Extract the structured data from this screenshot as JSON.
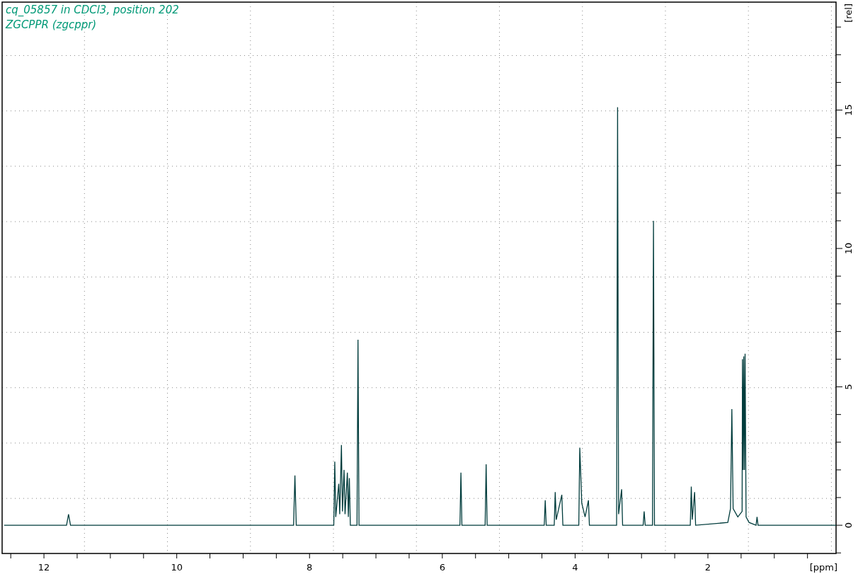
{
  "header": {
    "sample": "cq_05857 in CDCl3, position 202",
    "pulse_program": "ZGCPPR (zgcppr)"
  },
  "spectrum": {
    "chart_data": {
      "type": "line",
      "xlabel": "[ppm]",
      "ylabel": "[rel]",
      "xlim": [
        12.63,
        0.07
      ],
      "ylim": [
        -1.02,
        18.9
      ],
      "xticks": [
        12,
        10,
        8,
        6,
        4,
        2
      ],
      "yticks": [
        0,
        5,
        10,
        15
      ],
      "x": [
        12.6,
        11.66,
        11.63,
        11.6,
        8.24,
        8.22,
        8.2,
        7.635,
        7.62,
        7.605,
        7.56,
        7.545,
        7.52,
        7.505,
        7.48,
        7.465,
        7.43,
        7.415,
        7.4,
        7.385,
        7.285,
        7.27,
        7.255,
        5.735,
        5.72,
        5.705,
        5.355,
        5.34,
        5.325,
        4.465,
        4.45,
        4.435,
        4.315,
        4.3,
        4.285,
        4.2,
        4.185,
        3.945,
        3.93,
        3.9,
        3.85,
        3.8,
        3.785,
        3.375,
        3.36,
        3.345,
        3.3,
        3.285,
        2.975,
        2.96,
        2.945,
        2.835,
        2.82,
        2.805,
        2.265,
        2.25,
        2.235,
        2.2,
        2.185,
        1.7,
        1.66,
        1.64,
        1.62,
        1.55,
        1.485,
        1.48,
        1.47,
        1.46,
        1.45,
        1.44,
        1.425,
        1.38,
        1.275,
        1.26,
        1.245,
        0.07
      ],
      "series": [
        {
          "color": "#003c3c",
          "values": [
            0,
            0,
            0.4,
            0,
            0,
            1.8,
            0,
            0,
            2.3,
            0.3,
            1.5,
            0.4,
            2.9,
            0.5,
            2.0,
            0.4,
            1.9,
            0.3,
            1.7,
            0,
            0,
            6.7,
            0,
            0,
            1.9,
            0,
            0,
            2.2,
            0,
            0,
            0.9,
            0,
            0,
            1.2,
            0.2,
            1.1,
            0,
            0,
            2.8,
            0.8,
            0.3,
            0.9,
            0,
            0,
            15.1,
            0.4,
            1.3,
            0,
            0,
            0.5,
            0,
            0,
            11.0,
            0,
            0,
            1.4,
            0.2,
            1.2,
            0,
            0.1,
            0.6,
            4.2,
            0.6,
            0.3,
            0.5,
            6.0,
            2.0,
            6.1,
            2.0,
            6.2,
            0.3,
            0.1,
            0,
            0.3,
            0,
            0
          ]
        }
      ]
    }
  }
}
